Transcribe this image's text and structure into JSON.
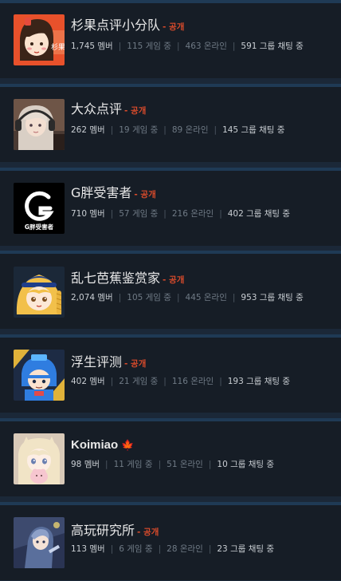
{
  "groups": [
    {
      "name": "杉果点评小分队",
      "visibility": "- 공개",
      "members": "1,745 멤버",
      "in_game": "115 게임 중",
      "online": "463 온라인",
      "chatting": "591 그룹 채팅 중",
      "avatar_text": "杉果",
      "accent": "#e8512b"
    },
    {
      "name": "大众点评",
      "visibility": "- 공개",
      "members": "262 멤버",
      "in_game": "19 게임 중",
      "online": "89 온라인",
      "chatting": "145 그룹 채팅 중",
      "accent": "#7a5a4a"
    },
    {
      "name": "G胖受害者",
      "visibility": "- 공개",
      "members": "710 멤버",
      "in_game": "57 게임 중",
      "online": "216 온라인",
      "chatting": "402 그룹 채팅 중",
      "avatar_text": "G胖受害者",
      "accent": "#000000"
    },
    {
      "name": "乱七芭蕉鉴赏家",
      "visibility": "- 공개",
      "members": "2,074 멤버",
      "in_game": "105 게임 중",
      "online": "445 온라인",
      "chatting": "953 그룹 채팅 중",
      "accent": "#f2c04a"
    },
    {
      "name": "浮生评测",
      "visibility": "- 공개",
      "members": "402 멤버",
      "in_game": "21 게임 중",
      "online": "116 온라인",
      "chatting": "193 그룹 채팅 중",
      "accent": "#2f7de0"
    },
    {
      "name": "Koimiao",
      "visibility": "",
      "members": "98 멤버",
      "in_game": "11 게임 중",
      "online": "51 온라인",
      "chatting": "10 그룹 채팅 중",
      "badge_icon": "maple-leaf-icon",
      "accent": "#e8261d"
    },
    {
      "name": "高玩研究所",
      "visibility": "- 공개",
      "members": "113 멤버",
      "in_game": "6 게임 중",
      "online": "28 온라인",
      "chatting": "23 그룹 채팅 중",
      "accent": "#3d4a6e"
    }
  ],
  "colors": {
    "page_background": "#1b2838",
    "card_background": "#161d26",
    "card_border": "#1f3a55",
    "visibility_text": "#d94b2b",
    "name_text": "#e8e8e8",
    "stat_highlight": "#c9ced3",
    "stat_dim": "#6f7a85"
  },
  "icons": {
    "maple": "🍁",
    "separator": "|"
  }
}
